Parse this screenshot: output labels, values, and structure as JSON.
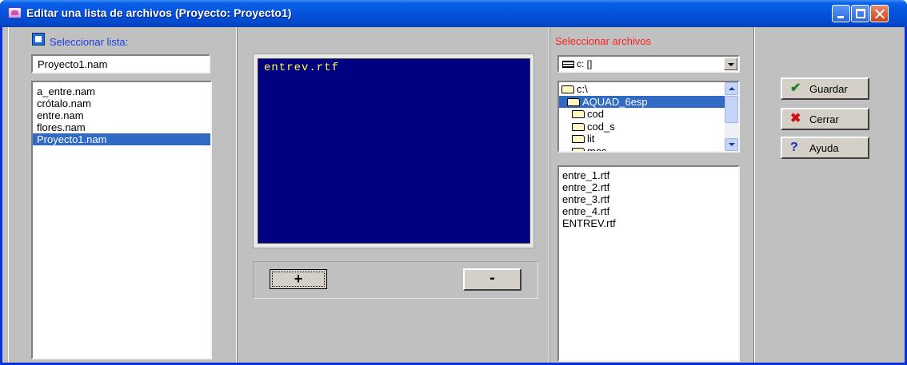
{
  "window": {
    "title": "Editar una lista de archivos (Proyecto: Proyecto1)"
  },
  "left": {
    "label": "Seleccionar lista:",
    "name_value": "Proyecto1.nam",
    "lists": [
      "a_entre.nam",
      "crótalo.nam",
      "entre.nam",
      "flores.nam",
      "Proyecto1.nam"
    ],
    "selected": "Proyecto1.nam"
  },
  "editor": {
    "text": "entrev.rtf"
  },
  "buttons": {
    "plus": "+",
    "minus": "-"
  },
  "files": {
    "label": "Seleccionar archivos",
    "drive": "c: []",
    "dirs": [
      "c:\\",
      "AQUAD_6esp",
      "cod",
      "cod_s",
      "lit",
      "mos"
    ],
    "selected_dir": "AQUAD_6esp",
    "file_list": [
      "entre_1.rtf",
      "entre_2.rtf",
      "entre_3.rtf",
      "entre_4.rtf",
      "ENTREV.rtf"
    ]
  },
  "actions": {
    "save": "Guardar",
    "close": "Cerrar",
    "help": "Ayuda"
  },
  "colors": {
    "accent": "#316ac5",
    "editor_bg": "#000080",
    "editor_text": "#ffff40",
    "label_red": "#ff2020",
    "label_blue": "#2040e0"
  },
  "icons": {
    "save": "check-icon",
    "close": "x-icon",
    "help": "question-icon"
  }
}
